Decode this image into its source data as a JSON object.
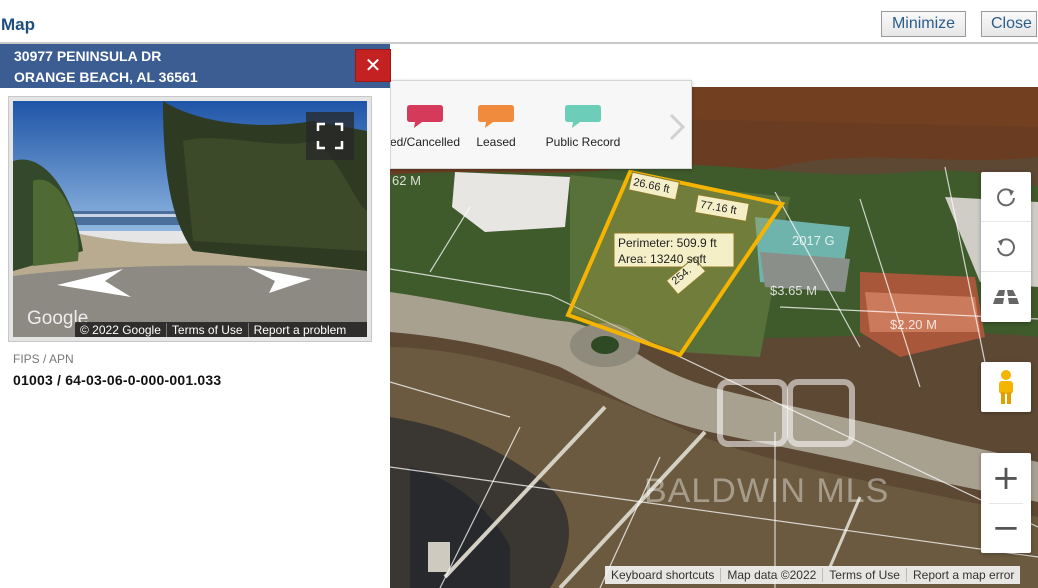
{
  "header": {
    "title": "Map",
    "minimize_label": "Minimize",
    "close_label": "Close"
  },
  "panel": {
    "address_line1": "30977 PENINSULA DR",
    "address_line2": "ORANGE BEACH, AL 36561",
    "close_icon": "close-x-icon",
    "street_view": {
      "google_logo": "Google",
      "copyright": "© 2022 Google",
      "terms": "Terms of Use",
      "report": "Report a problem",
      "fullscreen_icon": "fullscreen-icon",
      "nav_icons": [
        "arrow-left-icon",
        "arrow-right-icon"
      ]
    },
    "fips_label": "FIPS / APN",
    "fips_value": "01003 / 64-03-06-0-000-001.033"
  },
  "legend": {
    "items": [
      {
        "label": "ed/Cancelled",
        "color": "#d63a5a"
      },
      {
        "label": "Leased",
        "color": "#f08a3c"
      },
      {
        "label": "Public Record",
        "color": "#6ccdb8"
      }
    ],
    "next_icon": "chevron-right-icon"
  },
  "map": {
    "measure": {
      "perimeter": "Perimeter: 509.9 ft",
      "area": "Area: 13240 sqft"
    },
    "dimensions": [
      "26.66 ft",
      "77.16 ft",
      "254."
    ],
    "price_labels": [
      "62 M",
      "$3.65 M",
      "$2.20 M",
      "2017 G"
    ],
    "watermark": "BALDWIN MLS",
    "controls": {
      "rotate_cw_icon": "rotate-clockwise-icon",
      "rotate_ccw_icon": "rotate-counterclockwise-icon",
      "tilt_icon": "tilt-view-icon",
      "pegman_icon": "pegman-icon",
      "zoom_in": "+",
      "zoom_out": "−"
    },
    "attribution": [
      "Keyboard shortcuts",
      "Map data ©2022",
      "Terms of Use",
      "Report a map error"
    ],
    "outline_color": "#f4b400"
  }
}
